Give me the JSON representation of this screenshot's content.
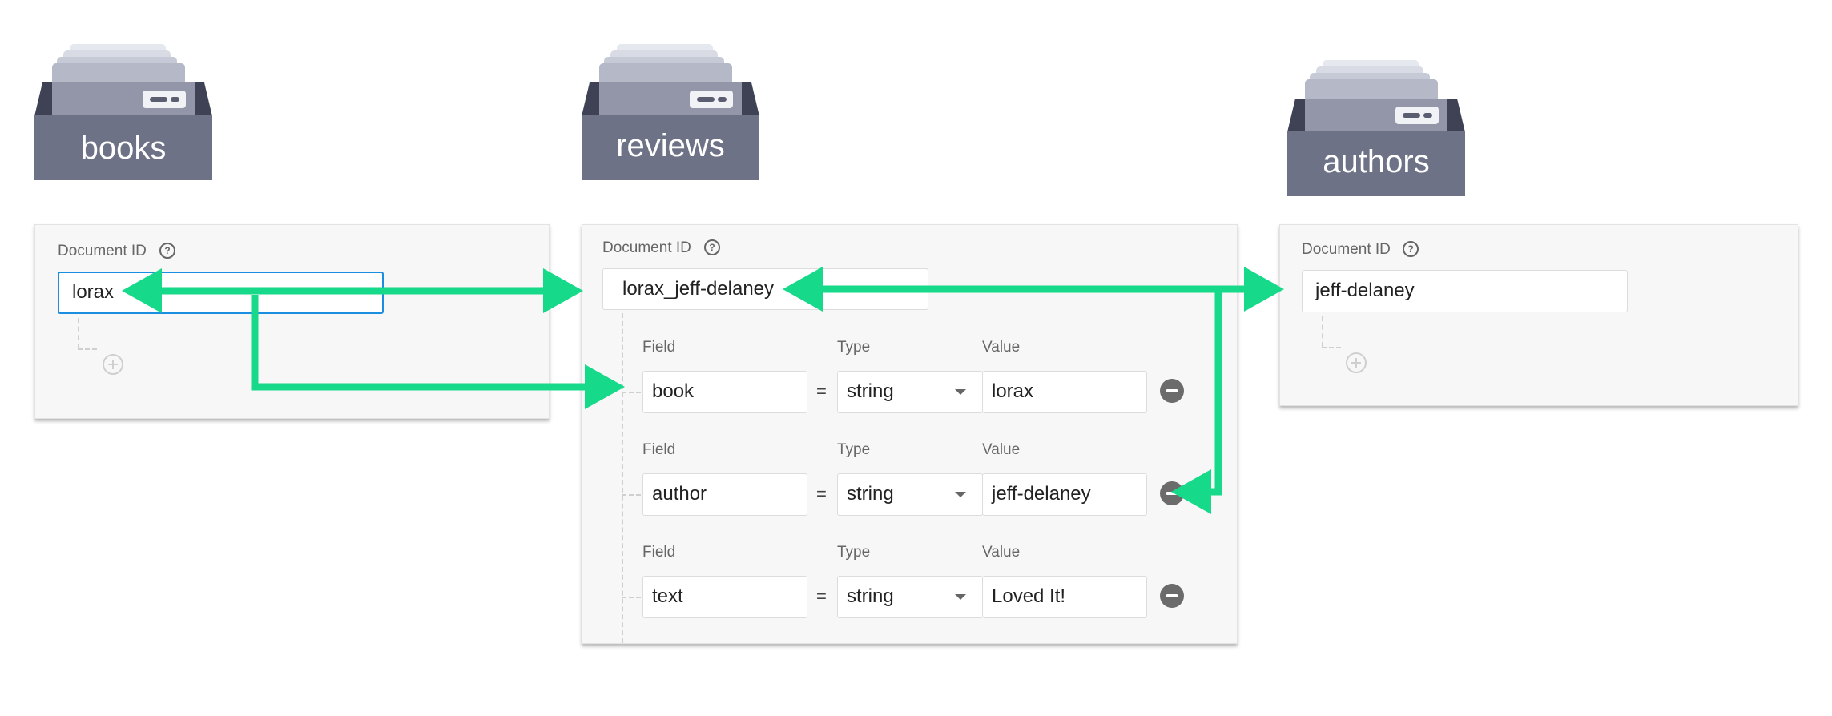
{
  "collections": [
    {
      "label": "books"
    },
    {
      "label": "reviews"
    },
    {
      "label": "authors"
    }
  ],
  "panels": {
    "books": {
      "doc_id_label": "Document ID",
      "doc_id": "lorax"
    },
    "reviews": {
      "doc_id_label": "Document ID",
      "doc_id": "lorax_jeff-delaney",
      "field_header": "Field",
      "type_header": "Type",
      "value_header": "Value",
      "equals": "=",
      "fields": [
        {
          "field": "book",
          "type": "string",
          "value": "lorax"
        },
        {
          "field": "author",
          "type": "string",
          "value": "jeff-delaney"
        },
        {
          "field": "text",
          "type": "string",
          "value": "Loved It!"
        }
      ]
    },
    "authors": {
      "doc_id_label": "Document ID",
      "doc_id": "jeff-delaney"
    }
  },
  "colors": {
    "arrow": "#17d98a",
    "folder_body": "#6d7287",
    "focus_border": "#1a8ee0"
  },
  "icons": [
    "folder-icon",
    "help-icon",
    "add-field-icon",
    "remove-field-icon",
    "dropdown-caret-icon"
  ]
}
